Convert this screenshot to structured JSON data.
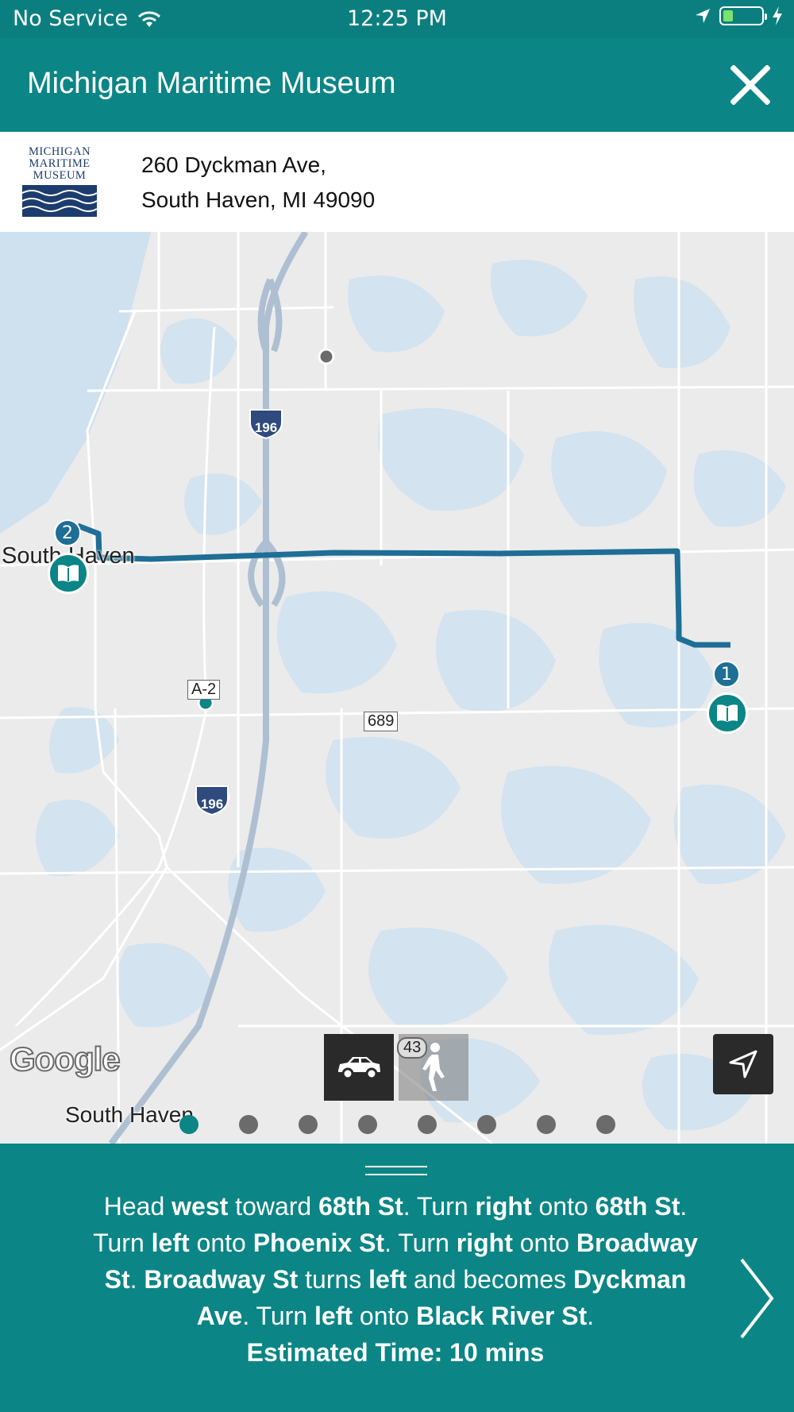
{
  "status_bar": {
    "carrier": "No Service",
    "time": "12:25 PM",
    "battery_level": 0.25,
    "icons": [
      "wifi-icon",
      "location-arrow-icon",
      "battery-icon",
      "charging-bolt-icon"
    ]
  },
  "header": {
    "title": "Michigan Maritime Museum",
    "close_icon": "close-icon"
  },
  "location": {
    "logo_lines": [
      "MICHIGAN",
      "MARITIME",
      "MUSEUM"
    ],
    "address_line1": "260 Dyckman Ave,",
    "address_line2": "South Haven, MI 49090"
  },
  "map": {
    "labels": {
      "city": "South Haven",
      "city_bottom": "South Haven",
      "highway_top": "196",
      "highway_bottom": "196",
      "route_a2": "A-2",
      "route_689": "689",
      "route_43": "43"
    },
    "markers": [
      {
        "number": "1",
        "icon": "book-icon"
      },
      {
        "number": "2",
        "icon": "book-icon"
      }
    ],
    "attribution": "Google",
    "modes": [
      {
        "name": "Driving",
        "icon": "car-icon",
        "selected": true
      },
      {
        "name": "Walking",
        "icon": "walking-person-icon",
        "selected": false
      }
    ],
    "locate_icon": "navigation-arrow-icon",
    "colors": {
      "route": "#1e6e96",
      "water": "#cfe0ee",
      "land": "#ebebeb",
      "accent": "#0b8585"
    }
  },
  "pager": {
    "total": 8,
    "active_index": 0
  },
  "directions": {
    "segments": [
      {
        "t": "Head ",
        "b": false
      },
      {
        "t": "west",
        "b": true
      },
      {
        "t": " toward ",
        "b": false
      },
      {
        "t": "68th St",
        "b": true
      },
      {
        "t": ". Turn ",
        "b": false
      },
      {
        "t": "right",
        "b": true
      },
      {
        "t": " onto ",
        "b": false
      },
      {
        "t": "68th St",
        "b": true
      },
      {
        "t": ". Turn ",
        "b": false
      },
      {
        "t": "left",
        "b": true
      },
      {
        "t": " onto ",
        "b": false
      },
      {
        "t": "Phoenix St",
        "b": true
      },
      {
        "t": ". Turn ",
        "b": false
      },
      {
        "t": "right",
        "b": true
      },
      {
        "t": " onto ",
        "b": false
      },
      {
        "t": "Broadway St",
        "b": true
      },
      {
        "t": ". ",
        "b": false
      },
      {
        "t": "Broadway St",
        "b": true
      },
      {
        "t": " turns ",
        "b": false
      },
      {
        "t": "left",
        "b": true
      },
      {
        "t": " and becomes ",
        "b": false
      },
      {
        "t": "Dyckman Ave",
        "b": true
      },
      {
        "t": ". Turn ",
        "b": false
      },
      {
        "t": "left",
        "b": true
      },
      {
        "t": " onto ",
        "b": false
      },
      {
        "t": "Black River St",
        "b": true
      },
      {
        "t": ".",
        "b": false
      }
    ],
    "estimated_time": "Estimated Time: 10 mins",
    "next_icon": "chevron-right-icon"
  }
}
